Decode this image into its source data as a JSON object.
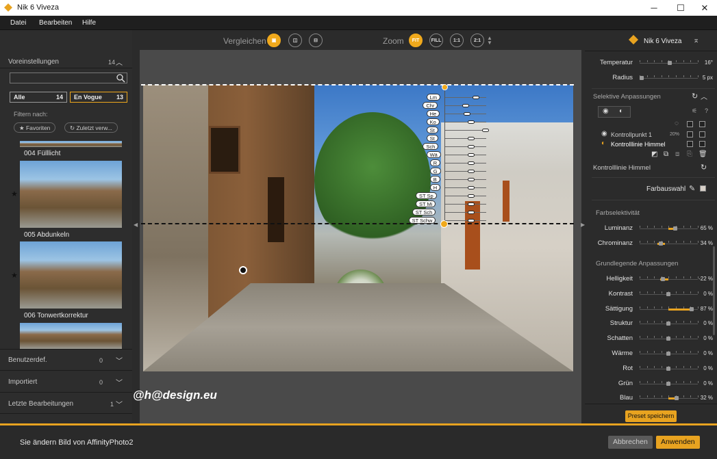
{
  "window": {
    "title": "Nik 6 Viveza",
    "minimize": "─",
    "maximize": "☐",
    "close": "✕"
  },
  "menu": [
    "Datei",
    "Bearbeiten",
    "Hilfe"
  ],
  "left_panel": {
    "presets_label": "Voreinstellungen",
    "presets_count": "14",
    "search_placeholder": "",
    "filter_all": {
      "label": "Alle",
      "count": "14"
    },
    "filter_vogue": {
      "label": "En Vogue",
      "count": "13"
    },
    "filter_by": "Filtern nach:",
    "favorites": "★ Favoriten",
    "recent": "↻ Zuletzt verw...",
    "thumbs": [
      {
        "label": "004 Fülllicht",
        "starred": false
      },
      {
        "label": "005 Abdunkeln",
        "starred": true
      },
      {
        "label": "006 Tonwertkorrektur",
        "starred": true
      }
    ],
    "user_label": "Benutzerdef.",
    "user_count": "0",
    "imported_label": "Importiert",
    "imported_count": "0",
    "recent_edits_label": "Letzte Bearbeitungen",
    "recent_edits_count": "1"
  },
  "toolbar": {
    "compare": "Vergleichen",
    "zoom": "Zoom",
    "fit": "FIT",
    "fill": "FILL",
    "one": "1:1",
    "two": "2:1"
  },
  "photo": {
    "control_labels": [
      "Lm",
      "Chr",
      "He",
      "Ko",
      "St",
      "St",
      "Sch",
      "Wä",
      "R",
      "G",
      "B",
      "H",
      "ST Sp",
      "ST Mi",
      "ST Sch",
      "ST Schw"
    ],
    "watermark": "@h@design.eu"
  },
  "right_panel": {
    "title": "Nik 6 Viveza",
    "temp": {
      "label": "Temperatur",
      "value": "16°"
    },
    "radius": {
      "label": "Radius",
      "value": "5 px"
    },
    "selective": "Selektive Anpassungen",
    "cp1": {
      "label": "Kontrollpunkt 1",
      "pct": "20%"
    },
    "cl": {
      "label": "Kontrolllinie Himmel"
    },
    "cl_header": "Kontrolllinie Himmel",
    "color_pick": "Farbauswahl",
    "color_sel": "Farbselektivität",
    "basic": "Grundlegende Anpassungen",
    "sliders_cs": [
      {
        "label": "Luminanz",
        "value": "65 %"
      },
      {
        "label": "Chrominanz",
        "value": "34 %"
      }
    ],
    "sliders_basic": [
      {
        "label": "Helligkeit",
        "value": "-22 %"
      },
      {
        "label": "Kontrast",
        "value": "0 %"
      },
      {
        "label": "Sättigung",
        "value": "87 %"
      },
      {
        "label": "Struktur",
        "value": "0 %"
      },
      {
        "label": "Schatten",
        "value": "0 %"
      },
      {
        "label": "Wärme",
        "value": "0 %"
      },
      {
        "label": "Rot",
        "value": "0 %"
      },
      {
        "label": "Grün",
        "value": "0 %"
      },
      {
        "label": "Blau",
        "value": "32 %"
      }
    ],
    "save_preset": "Preset speichern"
  },
  "bottom": {
    "message": "Sie ändern Bild von AffinityPhoto2",
    "cancel": "Abbrechen",
    "apply": "Anwenden"
  },
  "colors": {
    "accent": "#e8a320"
  }
}
